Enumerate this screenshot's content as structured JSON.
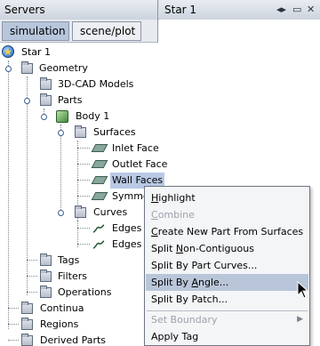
{
  "header": {
    "servers_label": "Servers",
    "sim_title": "Star 1",
    "controls": [
      "◂▸",
      "▭",
      "✕"
    ]
  },
  "tabs": [
    "simulation",
    "scene/plot"
  ],
  "tree": {
    "root": "Star 1",
    "geometry": "Geometry",
    "cad_models": "3D-CAD Models",
    "parts": "Parts",
    "body": "Body 1",
    "surfaces": "Surfaces",
    "surface_items": [
      "Inlet Face",
      "Outlet Face",
      "Wall Faces",
      "Symme"
    ],
    "curves": "Curves",
    "curve_items": [
      "Edges",
      "Edges"
    ],
    "tags": "Tags",
    "filters": "Filters",
    "operations": "Operations",
    "continua": "Continua",
    "regions": "Regions",
    "derived_parts": "Derived Parts"
  },
  "menu": {
    "items": [
      {
        "pre": "",
        "key": "H",
        "post": "ighlight",
        "disabled": false,
        "hover": false
      },
      {
        "pre": "",
        "key": "C",
        "post": "ombine",
        "disabled": true,
        "hover": false
      },
      {
        "pre": "",
        "key": "C",
        "post": "reate New Part From Surfaces",
        "disabled": false,
        "hover": false
      },
      {
        "pre": "Split ",
        "key": "N",
        "post": "on-Contiguous",
        "disabled": false,
        "hover": false
      },
      {
        "pre": "Split By Part Curves...",
        "key": "",
        "post": "",
        "disabled": false,
        "hover": false
      },
      {
        "pre": "Split By ",
        "key": "A",
        "post": "ngle...",
        "disabled": false,
        "hover": true
      },
      {
        "pre": "Split By Patch...",
        "key": "",
        "post": "",
        "disabled": false,
        "hover": false
      },
      {
        "pre": "Set Boundary",
        "key": "",
        "post": "",
        "disabled": true,
        "hover": false,
        "submenu": true
      },
      {
        "pre": "Apply Tag",
        "key": "",
        "post": "",
        "disabled": false,
        "hover": false
      }
    ]
  }
}
